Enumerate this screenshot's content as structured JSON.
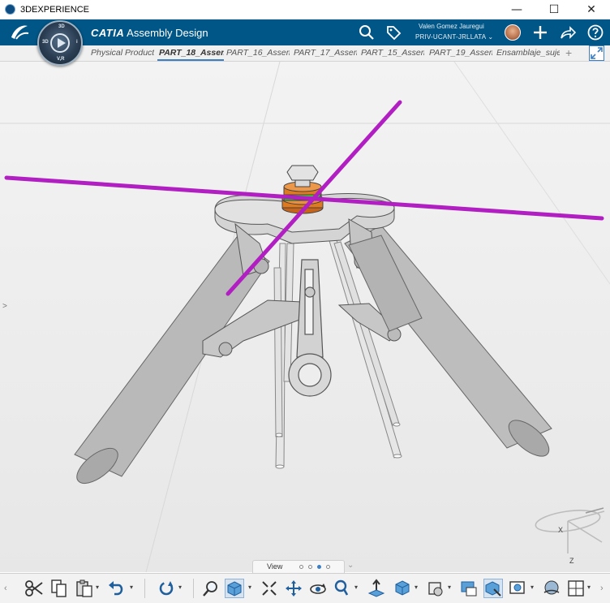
{
  "window": {
    "title": "3DEXPERIENCE",
    "minimize": "—",
    "maximize": "☐",
    "close": "✕"
  },
  "header": {
    "app_brand": "CATIA",
    "app_name": "Assembly Design",
    "compass": {
      "top_label": "3D",
      "left_label": "3D",
      "right_label": "i",
      "bottom_label": "V,R"
    },
    "user_name": "Valen Gomez Jauregui",
    "tenant": "PRIV-UCANT-JRLLATA",
    "tenant_caret": "⌄"
  },
  "tabs": [
    {
      "label": "Physical Product",
      "active": false
    },
    {
      "label": "PART_18_Assem",
      "active": true
    },
    {
      "label": "PART_16_Assem",
      "active": false
    },
    {
      "label": "PART_17_Assem",
      "active": false
    },
    {
      "label": "PART_15_Assem",
      "active": false
    },
    {
      "label": "PART_19_Assem",
      "active": false
    },
    {
      "label": "Ensamblaje_suje",
      "active": false
    }
  ],
  "tab_add": "+",
  "viewport": {
    "left_expand": ">",
    "axis_labels": {
      "x": "X",
      "z": "Z"
    }
  },
  "view_bar": {
    "label": "View",
    "pages": 4,
    "active_page": 2,
    "expand": "⌄"
  },
  "toolbar": {
    "scroll_left": "‹",
    "scroll_right": "›",
    "caret": "▾"
  },
  "colors": {
    "header_bg": "#005686",
    "axis_rod": "#b11fc3",
    "washer_orange": "#e07a1f",
    "washer_green": "#22c21c",
    "tube": "#b9b9b9",
    "tab_accent": "#3d7fc2"
  }
}
